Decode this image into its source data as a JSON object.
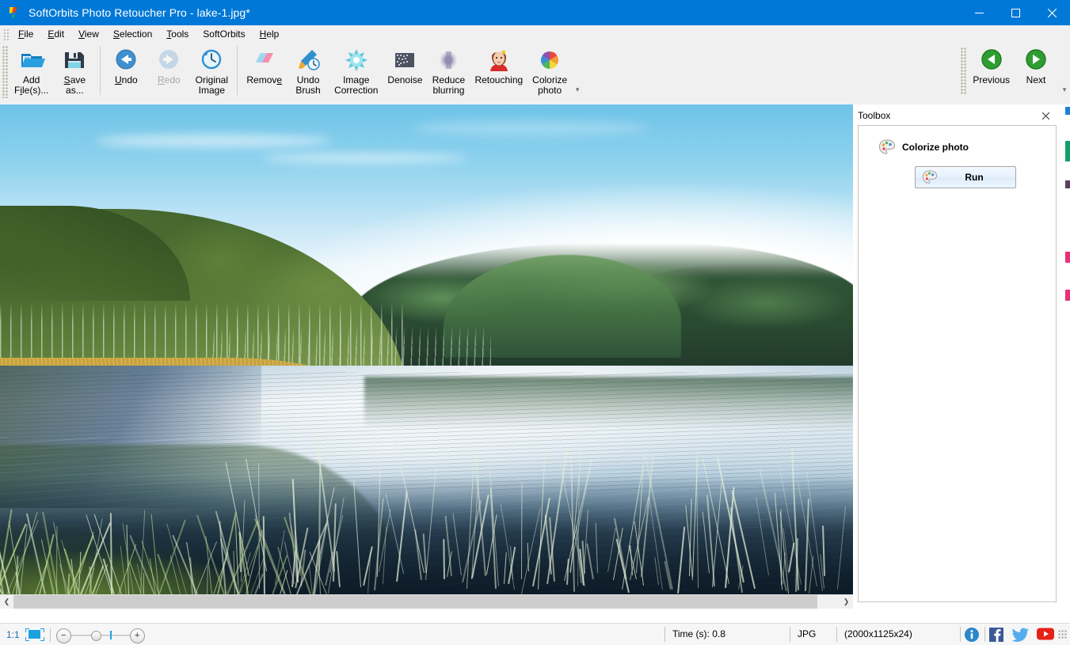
{
  "window": {
    "title": "SoftOrbits Photo Retoucher Pro - lake-1.jpg*",
    "app_icon": "softorbits-logo-icon",
    "controls": {
      "minimize": "minimize-icon",
      "maximize": "maximize-icon",
      "close": "close-icon"
    },
    "titlebar_color": "#0078d7"
  },
  "menubar": {
    "items": [
      {
        "label": "File",
        "accel_index": 0
      },
      {
        "label": "Edit",
        "accel_index": 0
      },
      {
        "label": "View",
        "accel_index": 0
      },
      {
        "label": "Selection",
        "accel_index": 0
      },
      {
        "label": "Tools",
        "accel_index": 0
      },
      {
        "label": "SoftOrbits",
        "accel_index": -1
      },
      {
        "label": "Help",
        "accel_index": 0
      }
    ]
  },
  "toolbar": {
    "groups": [
      {
        "buttons": [
          {
            "label": "Add\nFile(s)...",
            "icon": "open-folder-icon",
            "enabled": true
          },
          {
            "label": "Save\nas...",
            "icon": "floppy-disk-icon",
            "enabled": true
          }
        ]
      },
      {
        "buttons": [
          {
            "label": "Undo",
            "icon": "undo-arrow-icon",
            "enabled": true
          },
          {
            "label": "Redo",
            "icon": "redo-arrow-icon",
            "enabled": false
          },
          {
            "label": "Original\nImage",
            "icon": "clock-history-icon",
            "enabled": true
          }
        ]
      },
      {
        "buttons": [
          {
            "label": "Remove",
            "icon": "eraser-icon",
            "enabled": true
          },
          {
            "label": "Undo\nBrush",
            "icon": "brush-history-icon",
            "enabled": true
          },
          {
            "label": "Image\nCorrection",
            "icon": "brightness-icon",
            "enabled": true
          },
          {
            "label": "Denoise",
            "icon": "noise-grid-icon",
            "enabled": true
          },
          {
            "label": "Reduce\nblurring",
            "icon": "blur-circle-icon",
            "enabled": true
          },
          {
            "label": "Retouching",
            "icon": "portrait-face-icon",
            "enabled": true
          },
          {
            "label": "Colorize\nphoto",
            "icon": "color-wheel-icon",
            "enabled": true
          }
        ]
      }
    ],
    "navigation": [
      {
        "label": "Previous",
        "icon": "green-left-arrow-icon",
        "enabled": true
      },
      {
        "label": "Next",
        "icon": "green-right-arrow-icon",
        "enabled": true
      }
    ],
    "overflow_icon": "toolbar-overflow-icon"
  },
  "canvas": {
    "image_name": "lake-1.jpg",
    "scroll_left_icon": "scroll-left-arrow-icon",
    "scroll_right_icon": "scroll-right-arrow-icon"
  },
  "toolbox": {
    "title": "Toolbox",
    "close_icon": "close-icon",
    "tool": {
      "name": "Colorize photo",
      "icon": "palette-icon"
    },
    "run_button": {
      "label": "Run",
      "icon": "palette-icon"
    }
  },
  "statusbar": {
    "zoom_ratio": "1:1",
    "fit_icon": "fit-to-window-icon",
    "zoom_out_label": "−",
    "zoom_in_label": "+",
    "time": "Time (s): 0.8",
    "format": "JPG",
    "dimensions": "(2000x1125x24)",
    "links": [
      {
        "name": "info-icon",
        "title": "Info"
      },
      {
        "name": "facebook-icon",
        "title": "Facebook"
      },
      {
        "name": "twitter-icon",
        "title": "Twitter"
      },
      {
        "name": "youtube-icon",
        "title": "YouTube"
      }
    ],
    "resize_grip_icon": "resize-grip-icon"
  },
  "colors": {
    "accent": "#0078d7",
    "zoom_text": "#1a6fb5",
    "chrome": "#f0f0f0",
    "panel_border": "#c8c4bc"
  }
}
